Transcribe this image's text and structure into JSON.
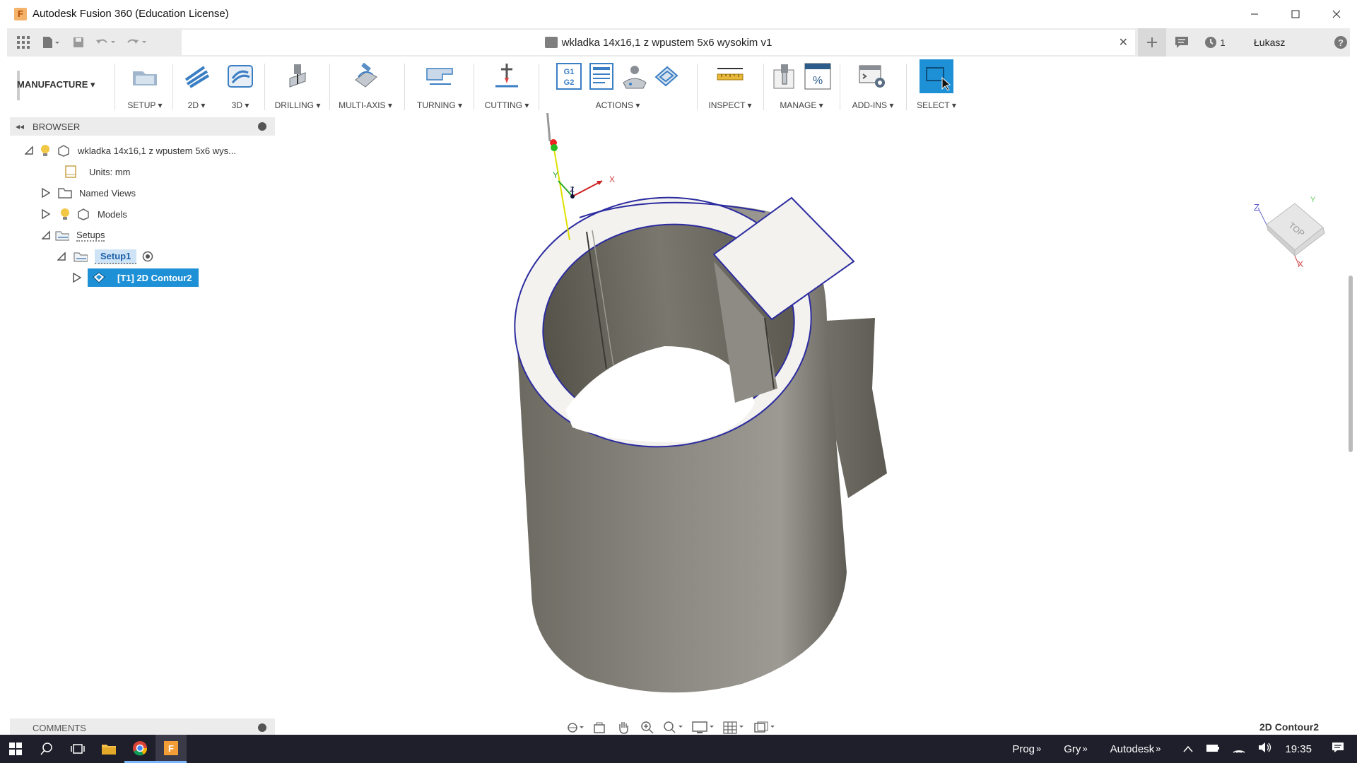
{
  "window": {
    "title": "Autodesk Fusion 360 (Education License)",
    "app_icon_letter": "F"
  },
  "quickbar": {
    "doc_tab_title": "wkladka 14x16,1 z wpustem 5x6 wysokim v1",
    "jobs_count": "1",
    "user_name": "Łukasz"
  },
  "ribbon": {
    "workspace": "MANUFACTURE",
    "groups": {
      "setup": "SETUP",
      "twod": "2D",
      "threed": "3D",
      "drilling": "DRILLING",
      "multiaxis": "MULTI-AXIS",
      "turning": "TURNING",
      "cutting": "CUTTING",
      "actions": "ACTIONS",
      "inspect": "INSPECT",
      "manage": "MANAGE",
      "addins": "ADD-INS",
      "select": "SELECT"
    },
    "actions_g1g2": "G1\nG2"
  },
  "browser": {
    "header": "BROWSER",
    "root": "wkladka 14x16,1 z wpustem 5x6 wys...",
    "units": "Units: mm",
    "named_views": "Named Views",
    "models": "Models",
    "setups": "Setups",
    "setup1": "Setup1",
    "operation": "[T1] 2D Contour2"
  },
  "viewport": {
    "viewcube_face": "TOP",
    "axis_labels": {
      "x": "X",
      "y": "Y",
      "z": "Z"
    }
  },
  "comments": {
    "label": "COMMENTS"
  },
  "status": {
    "selection": "2D Contour2"
  },
  "taskbar": {
    "toolbars": [
      "Prog",
      "Gry",
      "Autodesk"
    ],
    "clock": "19:35"
  }
}
